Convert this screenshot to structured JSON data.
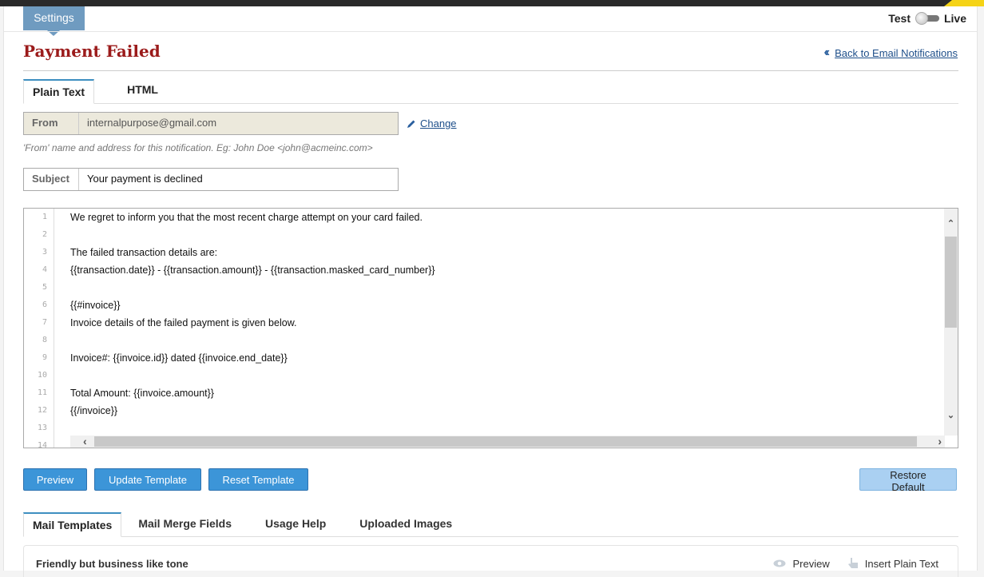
{
  "header": {
    "settings_tab": "Settings",
    "mode": {
      "left_label": "Test",
      "right_label": "Live",
      "selected": "Test"
    },
    "page_title": "Payment Failed",
    "back_link": "Back to Email Notifications"
  },
  "format_tabs": [
    {
      "label": "Plain Text",
      "active": true
    },
    {
      "label": "HTML",
      "active": false
    }
  ],
  "from": {
    "label": "From",
    "value": "internalpurpose@gmail.com",
    "change_label": "Change",
    "hint": "'From' name and address for this notification. Eg: John Doe <john@acmeinc.com>"
  },
  "subject": {
    "label": "Subject",
    "value": "Your payment is declined"
  },
  "editor": {
    "lines": [
      {
        "n": "1",
        "text": "We regret to inform you that the most recent charge attempt on your card failed."
      },
      {
        "n": "2",
        "text": ""
      },
      {
        "n": "3",
        "text": "The failed transaction details are:"
      },
      {
        "n": "4",
        "text": "{{transaction.date}} - {{transaction.amount}} - {{transaction.masked_card_number}}"
      },
      {
        "n": "5",
        "text": ""
      },
      {
        "n": "6",
        "text": "{{#invoice}}"
      },
      {
        "n": "7",
        "text": "Invoice details of the failed payment is given below."
      },
      {
        "n": "8",
        "text": ""
      },
      {
        "n": "9",
        "text": "Invoice#: {{invoice.id}} dated {{invoice.end_date}}"
      },
      {
        "n": "10",
        "text": ""
      },
      {
        "n": "11",
        "text": "Total Amount: {{invoice.amount}}"
      },
      {
        "n": "12",
        "text": "{{/invoice}}"
      },
      {
        "n": "13",
        "text": ""
      },
      {
        "n": "14",
        "text": ""
      }
    ]
  },
  "buttons": {
    "preview": "Preview",
    "update": "Update Template",
    "reset": "Reset Template",
    "restore": "Restore Default"
  },
  "bottom_tabs": [
    {
      "label": "Mail Templates",
      "active": true
    },
    {
      "label": "Mail Merge Fields",
      "active": false
    },
    {
      "label": "Usage Help",
      "active": false
    },
    {
      "label": "Uploaded Images",
      "active": false
    }
  ],
  "template_card": {
    "name": "Friendly but business like tone",
    "preview_label": "Preview",
    "insert_label": "Insert Plain Text"
  },
  "colors": {
    "title": "#9b1b1b",
    "accent_button": "#3c95d8",
    "restore_button": "#aad0f2",
    "settings_tab": "#6f9bc0",
    "link": "#1e4f8a"
  }
}
